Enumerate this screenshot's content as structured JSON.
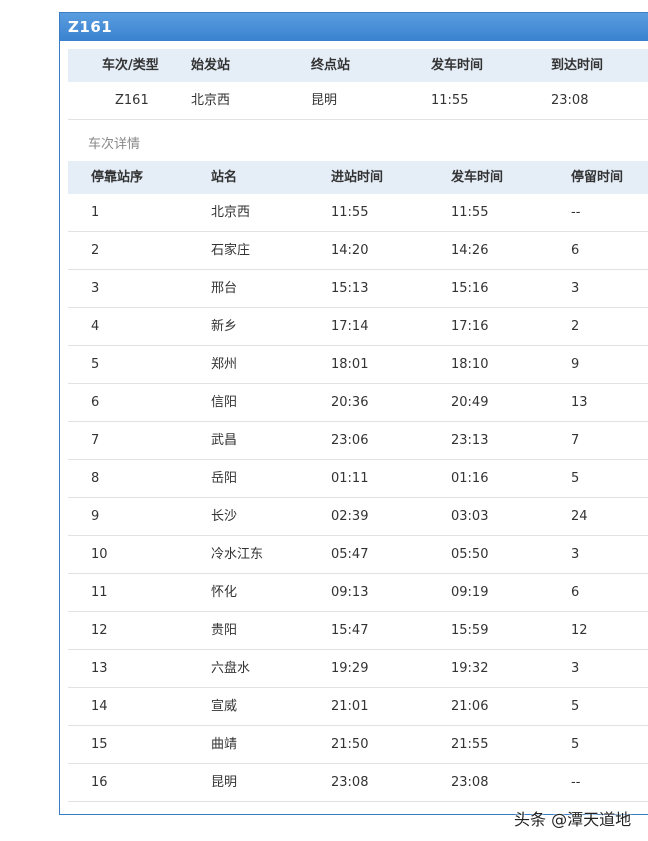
{
  "title": "Z161",
  "summary": {
    "headers": [
      "车次/类型",
      "始发站",
      "终点站",
      "发车时间",
      "到达时间"
    ],
    "values": [
      "Z161",
      "北京西",
      "昆明",
      "11:55",
      "23:08"
    ]
  },
  "detail_label": "车次详情",
  "details": {
    "headers": [
      "停靠站序",
      "站名",
      "进站时间",
      "发车时间",
      "停留时间"
    ],
    "rows": [
      [
        "1",
        "北京西",
        "11:55",
        "11:55",
        "--"
      ],
      [
        "2",
        "石家庄",
        "14:20",
        "14:26",
        "6"
      ],
      [
        "3",
        "邢台",
        "15:13",
        "15:16",
        "3"
      ],
      [
        "4",
        "新乡",
        "17:14",
        "17:16",
        "2"
      ],
      [
        "5",
        "郑州",
        "18:01",
        "18:10",
        "9"
      ],
      [
        "6",
        "信阳",
        "20:36",
        "20:49",
        "13"
      ],
      [
        "7",
        "武昌",
        "23:06",
        "23:13",
        "7"
      ],
      [
        "8",
        "岳阳",
        "01:11",
        "01:16",
        "5"
      ],
      [
        "9",
        "长沙",
        "02:39",
        "03:03",
        "24"
      ],
      [
        "10",
        "冷水江东",
        "05:47",
        "05:50",
        "3"
      ],
      [
        "11",
        "怀化",
        "09:13",
        "09:19",
        "6"
      ],
      [
        "12",
        "贵阳",
        "15:47",
        "15:59",
        "12"
      ],
      [
        "13",
        "六盘水",
        "19:29",
        "19:32",
        "3"
      ],
      [
        "14",
        "宣威",
        "21:01",
        "21:06",
        "5"
      ],
      [
        "15",
        "曲靖",
        "21:50",
        "21:55",
        "5"
      ],
      [
        "16",
        "昆明",
        "23:08",
        "23:08",
        "--"
      ]
    ]
  },
  "watermark": "头条 @潭天道地"
}
